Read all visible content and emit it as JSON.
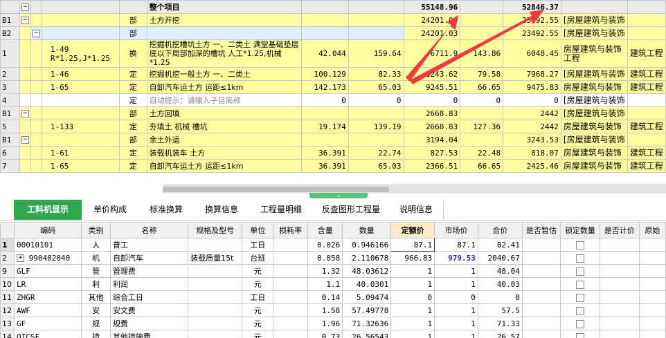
{
  "top_rows": [
    {
      "ref": "",
      "cls": "title",
      "tree": "minus",
      "code": "",
      "type": "",
      "name": "整个项目",
      "q": "",
      "p": "",
      "total": "55148.96",
      "c5": "",
      "c6": "52846.37",
      "cat": "",
      "sp": ""
    },
    {
      "ref": "B1",
      "tree": "minus",
      "code": "",
      "type": "部",
      "name": "土方开挖",
      "q": "",
      "p": "",
      "total": "24201.03",
      "c5": "",
      "c6": "23492.55",
      "cat": "[房屋建筑与装饰",
      "sp": ""
    },
    {
      "ref": "B2",
      "tree": "minus2",
      "code": "",
      "type": "部",
      "name": "",
      "q": "",
      "p": "",
      "total": "24201.03",
      "c5": "",
      "c6": "23492.55",
      "cat": "[房屋建筑与装饰",
      "sp": ""
    },
    {
      "ref": "1",
      "tall": true,
      "code": "1-49\nR*1.25,J*1.25",
      "type": "换",
      "name": "挖掘机挖槽坑土方 一、二类土  满堂基础垫层底以下局部加深的槽坑 人工*1.25,机械*1.25",
      "q": "42.044",
      "p": "159.64",
      "total": "6711.9",
      "c5": "143.86",
      "c6": "6048.45",
      "cat": "房屋建筑与装饰工程",
      "sp": "建筑工程"
    },
    {
      "ref": "2",
      "code": "1-46",
      "type": "定",
      "name": "挖掘机挖一般土方 一、二类土",
      "q": "100.129",
      "p": "82.33",
      "total": "8243.62",
      "c5": "79.58",
      "c6": "7968.27",
      "cat": "[房屋建筑与装饰",
      "sp": "建筑工程"
    },
    {
      "ref": "3",
      "code": "1-65",
      "type": "定",
      "name": "自卸汽车运土方 运距≤1km",
      "q": "142.173",
      "p": "65.03",
      "total": "9245.51",
      "c5": "66.65",
      "c6": "9475.83",
      "cat": "房屋建筑与装饰",
      "sp": "建筑工程"
    },
    {
      "ref": "4",
      "cls": "r4",
      "code": "",
      "type": "定",
      "name": "自动提示：请输入子目简称",
      "q": "0",
      "p": "0",
      "total": "0",
      "c5": "0",
      "c6": "0",
      "cat": "[房屋建筑与装饰",
      "sp": ""
    },
    {
      "ref": "B1",
      "tree": "minus",
      "code": "",
      "type": "部",
      "name": "土方回填",
      "q": "",
      "p": "",
      "total": "2668.83",
      "c5": "",
      "c6": "2442",
      "cat": "[房屋建筑与装饰",
      "sp": ""
    },
    {
      "ref": "5",
      "code": "1-133",
      "type": "定",
      "name": "夯填土 机械 槽坑",
      "q": "19.174",
      "p": "139.19",
      "total": "2668.83",
      "c5": "127.36",
      "c6": "2442",
      "cat": "房屋建筑与装饰",
      "sp": "建筑工程"
    },
    {
      "ref": "B1",
      "tree": "minus",
      "code": "",
      "type": "部",
      "name": "余土外运",
      "q": "",
      "p": "",
      "total": "3194.04",
      "c5": "",
      "c6": "3243.53",
      "cat": "[房屋建筑与装饰",
      "sp": ""
    },
    {
      "ref": "6",
      "code": "1-61",
      "type": "定",
      "name": "装载机装车 土方",
      "q": "36.391",
      "p": "22.74",
      "total": "827.53",
      "c5": "22.48",
      "c6": "818.07",
      "cat": "房屋建筑与装饰",
      "sp": "建筑工程"
    },
    {
      "ref": "7",
      "code": "1-65",
      "type": "定",
      "name": "自卸汽车运土方 运距≤1km",
      "q": "36.391",
      "p": "65.03",
      "total": "2366.51",
      "c5": "66.65",
      "c6": "2425.46",
      "cat": "房屋建筑与装饰",
      "sp": "建筑工程"
    }
  ],
  "tabs": [
    "工料机显示",
    "单价构成",
    "标准换算",
    "换算信息",
    "工程量明细",
    "反查图形工程量",
    "说明信息"
  ],
  "bottom_headers": [
    "",
    "编码",
    "类别",
    "名称",
    "规格及型号",
    "单位",
    "损耗率",
    "含量",
    "数量",
    "定额价",
    "市场价",
    "合价",
    "是否暂估",
    "锁定数量",
    "是否计价",
    "原始"
  ],
  "bottom_rows": [
    {
      "n": "1",
      "code": "00010101",
      "cat": "人",
      "name": "普工",
      "spec": "",
      "unit": "工日",
      "loss": "",
      "content": "0.026",
      "qty": "0.946166",
      "quota": "87.1",
      "market": "87.1",
      "total": "82.41"
    },
    {
      "n": "2",
      "expand": true,
      "code": "990402040",
      "cat": "机",
      "name": "自卸汽车",
      "spec": "装载质量15t",
      "unit": "台班",
      "loss": "",
      "content": "0.058",
      "qty": "2.110678",
      "quota": "966.83",
      "market": "979.53",
      "total": "2040.67",
      "blue": true
    },
    {
      "n": "9",
      "code": "GLF",
      "cat": "管",
      "name": "管理费",
      "spec": "",
      "unit": "元",
      "loss": "",
      "content": "1.32",
      "qty": "48.03612",
      "quota": "1",
      "market": "1",
      "total": "48.04"
    },
    {
      "n": "10",
      "code": "LR",
      "cat": "利",
      "name": "利润",
      "spec": "",
      "unit": "元",
      "loss": "",
      "content": "1.1",
      "qty": "40.0301",
      "quota": "1",
      "market": "1",
      "total": "40.03"
    },
    {
      "n": "11",
      "code": "ZHGR",
      "cat": "其他",
      "name": "综合工日",
      "spec": "",
      "unit": "工日",
      "loss": "",
      "content": "0.14",
      "qty": "5.09474",
      "quota": "0",
      "market": "0",
      "total": "0"
    },
    {
      "n": "12",
      "code": "AWF",
      "cat": "安",
      "name": "安文费",
      "spec": "",
      "unit": "元",
      "loss": "",
      "content": "1.58",
      "qty": "57.49778",
      "quota": "1",
      "market": "1",
      "total": "57.5"
    },
    {
      "n": "13",
      "code": "GF",
      "cat": "规",
      "name": "规费",
      "spec": "",
      "unit": "元",
      "loss": "",
      "content": "1.96",
      "qty": "71.32636",
      "quota": "1",
      "market": "1",
      "total": "71.33"
    },
    {
      "n": "14",
      "code": "QTCSF",
      "cat": "措",
      "name": "其他措施费",
      "spec": "",
      "unit": "元",
      "loss": "",
      "content": "0.73",
      "qty": "26.56543",
      "quota": "1",
      "market": "1",
      "total": "26.57"
    }
  ]
}
